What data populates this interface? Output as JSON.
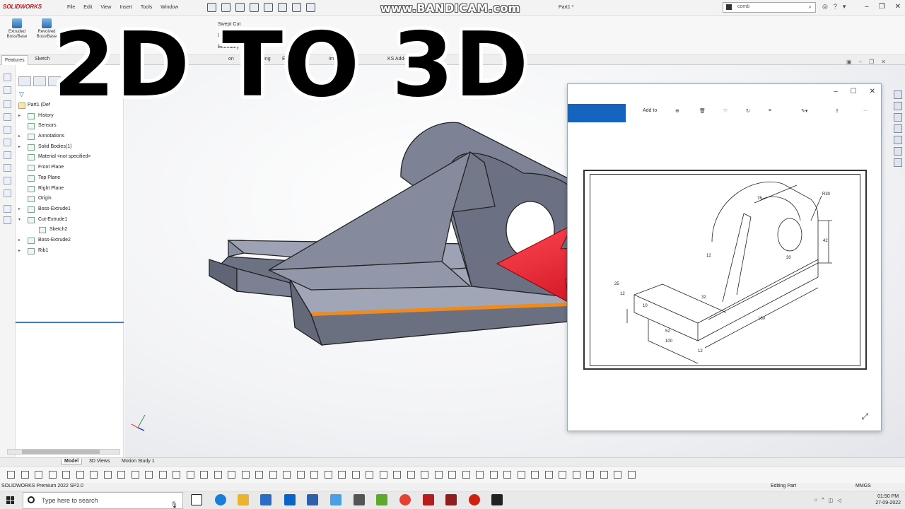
{
  "app": {
    "logo": "SOLIDWORKS",
    "menu": [
      "File",
      "Edit",
      "View",
      "Insert",
      "Tools",
      "Window"
    ],
    "doc_title": "Part1 *",
    "search_value": "comb"
  },
  "ribbon": {
    "extruded": "Extruded Boss/Base",
    "revolved": "Revolved Boss/Base",
    "swept_cut": "Swept Cut",
    "lofted_cut": "Lofted Cut",
    "boundary_cut": "Boundary Cut"
  },
  "tabs": {
    "features": "Features",
    "sketch": "Sketch",
    "tools": "Tools",
    "direct_editing": "Direct Editing",
    "evaluate": "Eva",
    "dimension": "imensio",
    "addins": "KS Add-",
    "section_on": "on"
  },
  "tree": {
    "root": "Part1 (Def",
    "items": [
      {
        "label": "History",
        "expandable": true
      },
      {
        "label": "Sensors",
        "expandable": false
      },
      {
        "label": "Annotations",
        "expandable": true
      },
      {
        "label": "Solid Bodies(1)",
        "expandable": true
      },
      {
        "label": "Material <not specified>",
        "expandable": false
      },
      {
        "label": "Front Plane",
        "expandable": false
      },
      {
        "label": "Top Plane",
        "expandable": false
      },
      {
        "label": "Right Plane",
        "expandable": false
      },
      {
        "label": "Origin",
        "expandable": false
      },
      {
        "label": "Boss-Extrude1",
        "expandable": true
      },
      {
        "label": "Cut-Extrude1",
        "expandable": true,
        "expanded": true
      },
      {
        "label": "Sketch2",
        "expandable": false,
        "child": true
      },
      {
        "label": "Boss-Extrude2",
        "expandable": true
      },
      {
        "label": "Rib1",
        "expandable": true
      }
    ]
  },
  "overlay": {
    "title": "2D TO 3D",
    "watermark": "www.BANDICAM.com"
  },
  "photo_viewer": {
    "add_to": "Add to",
    "dims": {
      "r30": "R30",
      "d76": "76",
      "d42": "42",
      "d30": "30",
      "d12a": "12",
      "d32": "32",
      "d160": "160",
      "d52": "52",
      "d100": "100",
      "d12b": "12",
      "d25": "25",
      "d12c": "12",
      "d10": "10"
    }
  },
  "bottom": {
    "tab_model": "Model",
    "tab_3dviews": "3D Views",
    "tab_motion": "Motion Study 1",
    "status_left": "SOLIDWORKS Premium 2022 SP2.0",
    "status_editing": "Editing Part",
    "status_units": "MMGS"
  },
  "taskbar": {
    "search_placeholder": "Type here to search",
    "time": "01:50 PM",
    "date": "27-09-2022"
  },
  "colors": {
    "accent_red": "#c4161c",
    "arrow_red": "#e01020",
    "part_gray": "#7a7f8f"
  }
}
